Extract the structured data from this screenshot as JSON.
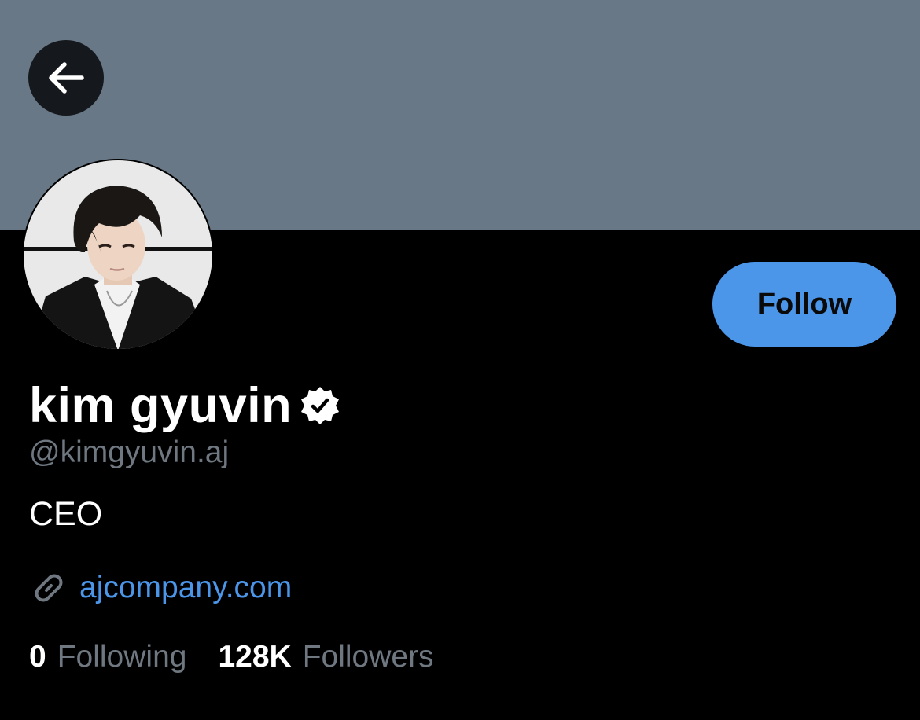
{
  "profile": {
    "display_name": "kim gyuvin",
    "handle": "@kimgyuvin.aj",
    "bio": "CEO",
    "website": "ajcompany.com",
    "verified": true
  },
  "actions": {
    "follow_label": "Follow"
  },
  "stats": {
    "following_count": "0",
    "following_label": "Following",
    "followers_count": "128K",
    "followers_label": "Followers"
  },
  "icons": {
    "back": "arrow-left-icon",
    "verified": "verified-badge-icon",
    "link": "link-icon"
  },
  "colors": {
    "banner": "#697886",
    "background": "#000000",
    "accent": "#4c96ea",
    "muted_text": "#6f7780",
    "primary_text": "#ffffff"
  }
}
